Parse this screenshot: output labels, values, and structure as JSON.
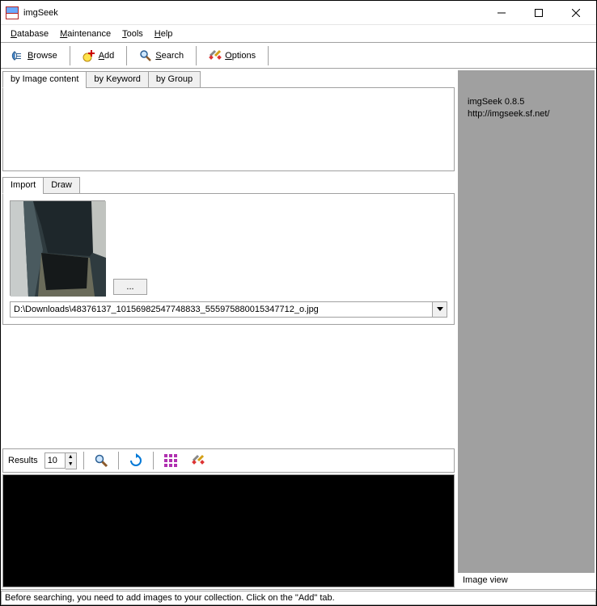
{
  "title": "imgSeek",
  "menu": {
    "database": "Database",
    "maintenance": "Maintenance",
    "tools": "Tools",
    "help": "Help"
  },
  "toolbar": {
    "browse": "Browse",
    "add": "Add",
    "search": "Search",
    "options": "Options"
  },
  "searchTabs": {
    "byImage": "by Image content",
    "byKeyword": "by Keyword",
    "byGroup": "by Group"
  },
  "innerTabs": {
    "import": "Import",
    "draw": "Draw"
  },
  "moreBtn": "...",
  "filePath": "D:\\Downloads\\48376137_10156982547748833_555975880015347712_o.jpg",
  "results": {
    "label": "Results",
    "count": "10"
  },
  "sidePanel": {
    "line1": "imgSeek 0.8.5",
    "line2": "http://imgseek.sf.net/",
    "caption": "Image view"
  },
  "status": "Before searching, you need to add images to your collection. Click on the \"Add\" tab."
}
